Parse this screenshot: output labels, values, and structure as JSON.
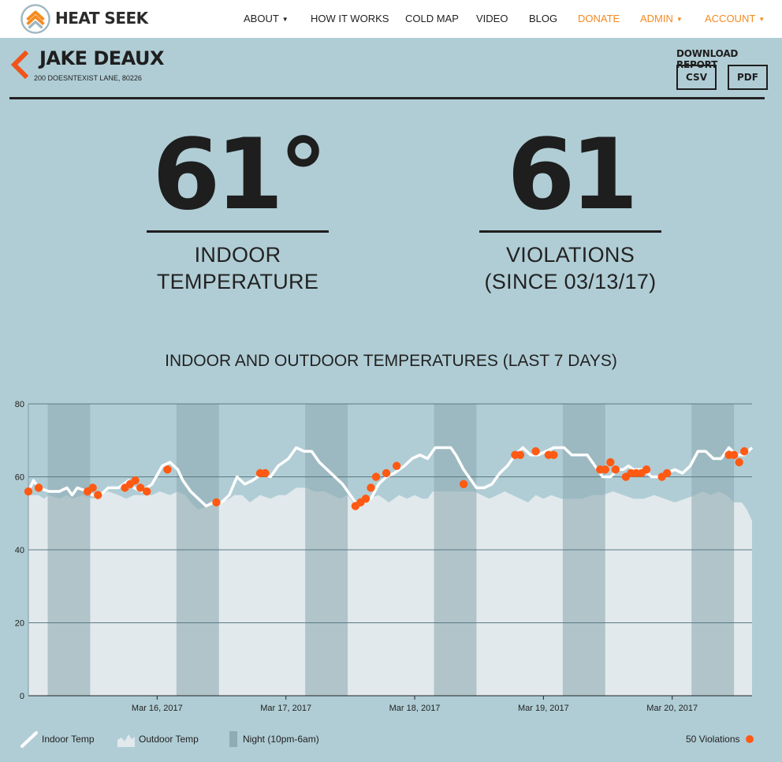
{
  "app": {
    "brand": "HEAT SEEK",
    "nav": [
      {
        "label": "ABOUT",
        "dropdown": true,
        "orange": false
      },
      {
        "label": "HOW IT WORKS",
        "dropdown": false,
        "orange": false
      },
      {
        "label": "COLD MAP",
        "dropdown": false,
        "orange": false
      },
      {
        "label": "VIDEO",
        "dropdown": false,
        "orange": false
      },
      {
        "label": "BLOG",
        "dropdown": false,
        "orange": false
      },
      {
        "label": "DONATE",
        "dropdown": false,
        "orange": true
      },
      {
        "label": "ADMIN",
        "dropdown": true,
        "orange": true
      },
      {
        "label": "ACCOUNT",
        "dropdown": true,
        "orange": true
      }
    ]
  },
  "tenant": {
    "name": "JAKE DEAUX",
    "address": "200 DOESNTEXIST LANE, 80226"
  },
  "download": {
    "label": "DOWNLOAD REPORT",
    "csv": "CSV",
    "pdf": "PDF"
  },
  "stats": {
    "temperature": {
      "value": "61°",
      "label_line1": "INDOOR",
      "label_line2": "TEMPERATURE"
    },
    "violations": {
      "value": "61",
      "label_line1": "VIOLATIONS",
      "label_line2": "(SINCE 03/13/17)"
    }
  },
  "colors": {
    "background": "#b0cdd5",
    "accent_orange": "#f58a1f",
    "violation": "#ff5a14",
    "indoor_line": "#ffffff",
    "outdoor_area": "#e1e9ec",
    "night_band": "#8fabb4"
  },
  "chart_data": {
    "type": "line",
    "title": "INDOOR AND OUTDOOR TEMPERATURES (LAST 7 DAYS)",
    "ylim": [
      0,
      80
    ],
    "yticks": [
      "0",
      "20",
      "40",
      "60",
      "80"
    ],
    "x_tick_labels": [
      {
        "label": "Mar 16, 2017",
        "t": 1.0
      },
      {
        "label": "Mar 17, 2017",
        "t": 2.0
      },
      {
        "label": "Mar 18, 2017",
        "t": 3.0
      },
      {
        "label": "Mar 19, 2017",
        "t": 4.0
      },
      {
        "label": "Mar 20, 2017",
        "t": 5.0
      }
    ],
    "x_range_days": [
      0.0,
      5.62
    ],
    "night_bands": [
      [
        0.15,
        0.48
      ],
      [
        1.15,
        1.48
      ],
      [
        2.15,
        2.48
      ],
      [
        3.15,
        3.48
      ],
      [
        4.15,
        4.48
      ],
      [
        5.15,
        5.48
      ]
    ],
    "series": [
      {
        "name": "Indoor Temp",
        "points": [
          [
            0.0,
            56
          ],
          [
            0.04,
            59
          ],
          [
            0.08,
            57
          ],
          [
            0.16,
            56
          ],
          [
            0.24,
            56
          ],
          [
            0.3,
            57
          ],
          [
            0.34,
            55
          ],
          [
            0.38,
            57
          ],
          [
            0.46,
            56
          ],
          [
            0.5,
            55
          ],
          [
            0.56,
            55
          ],
          [
            0.62,
            57
          ],
          [
            0.7,
            57
          ],
          [
            0.78,
            59
          ],
          [
            0.82,
            57
          ],
          [
            0.88,
            56
          ],
          [
            0.96,
            58
          ],
          [
            1.04,
            63
          ],
          [
            1.1,
            64
          ],
          [
            1.16,
            62
          ],
          [
            1.2,
            59
          ],
          [
            1.26,
            56
          ],
          [
            1.32,
            54
          ],
          [
            1.38,
            52
          ],
          [
            1.44,
            53
          ],
          [
            1.5,
            53
          ],
          [
            1.56,
            55
          ],
          [
            1.62,
            60
          ],
          [
            1.68,
            58
          ],
          [
            1.74,
            59
          ],
          [
            1.82,
            61
          ],
          [
            1.88,
            60
          ],
          [
            1.94,
            63
          ],
          [
            2.02,
            65
          ],
          [
            2.08,
            68
          ],
          [
            2.14,
            67
          ],
          [
            2.2,
            67
          ],
          [
            2.26,
            64
          ],
          [
            2.32,
            62
          ],
          [
            2.38,
            60
          ],
          [
            2.44,
            58
          ],
          [
            2.52,
            54
          ],
          [
            2.56,
            52
          ],
          [
            2.6,
            53
          ],
          [
            2.66,
            54
          ],
          [
            2.72,
            58
          ],
          [
            2.78,
            60
          ],
          [
            2.84,
            61
          ],
          [
            2.92,
            63
          ],
          [
            2.98,
            65
          ],
          [
            3.04,
            66
          ],
          [
            3.1,
            65
          ],
          [
            3.16,
            68
          ],
          [
            3.22,
            68
          ],
          [
            3.28,
            68
          ],
          [
            3.32,
            66
          ],
          [
            3.38,
            62
          ],
          [
            3.44,
            59
          ],
          [
            3.48,
            57
          ],
          [
            3.54,
            57
          ],
          [
            3.6,
            58
          ],
          [
            3.66,
            61
          ],
          [
            3.72,
            63
          ],
          [
            3.78,
            66
          ],
          [
            3.84,
            68
          ],
          [
            3.9,
            66
          ],
          [
            3.96,
            66
          ],
          [
            4.02,
            67
          ],
          [
            4.08,
            68
          ],
          [
            4.16,
            68
          ],
          [
            4.22,
            66
          ],
          [
            4.28,
            66
          ],
          [
            4.34,
            66
          ],
          [
            4.4,
            63
          ],
          [
            4.46,
            60
          ],
          [
            4.52,
            60
          ],
          [
            4.58,
            62
          ],
          [
            4.62,
            62
          ],
          [
            4.66,
            63
          ],
          [
            4.7,
            62
          ],
          [
            4.74,
            62
          ],
          [
            4.78,
            62
          ],
          [
            4.84,
            60
          ],
          [
            4.9,
            60
          ],
          [
            4.96,
            61
          ],
          [
            5.02,
            62
          ],
          [
            5.08,
            61
          ],
          [
            5.14,
            63
          ],
          [
            5.2,
            67
          ],
          [
            5.26,
            67
          ],
          [
            5.32,
            65
          ],
          [
            5.38,
            65
          ],
          [
            5.44,
            68
          ],
          [
            5.5,
            66
          ],
          [
            5.56,
            66
          ],
          [
            5.62,
            68
          ]
        ]
      },
      {
        "name": "Outdoor Temp",
        "points": [
          [
            0.0,
            55
          ],
          [
            0.08,
            55
          ],
          [
            0.12,
            54
          ],
          [
            0.16,
            55
          ],
          [
            0.24,
            54
          ],
          [
            0.3,
            55
          ],
          [
            0.34,
            54
          ],
          [
            0.42,
            55
          ],
          [
            0.5,
            54
          ],
          [
            0.56,
            55
          ],
          [
            0.62,
            56
          ],
          [
            0.7,
            55
          ],
          [
            0.76,
            54
          ],
          [
            0.82,
            55
          ],
          [
            0.88,
            55
          ],
          [
            0.96,
            55
          ],
          [
            1.02,
            56
          ],
          [
            1.1,
            55
          ],
          [
            1.16,
            56
          ],
          [
            1.22,
            55
          ],
          [
            1.26,
            53
          ],
          [
            1.32,
            51
          ],
          [
            1.4,
            52
          ],
          [
            1.44,
            53
          ],
          [
            1.5,
            53
          ],
          [
            1.56,
            54
          ],
          [
            1.6,
            55
          ],
          [
            1.66,
            55
          ],
          [
            1.72,
            53
          ],
          [
            1.8,
            55
          ],
          [
            1.88,
            54
          ],
          [
            1.94,
            55
          ],
          [
            2.0,
            55
          ],
          [
            2.08,
            57
          ],
          [
            2.16,
            57
          ],
          [
            2.22,
            56
          ],
          [
            2.3,
            56
          ],
          [
            2.36,
            55
          ],
          [
            2.42,
            54
          ],
          [
            2.48,
            55
          ],
          [
            2.52,
            53
          ],
          [
            2.58,
            53
          ],
          [
            2.64,
            54
          ],
          [
            2.72,
            55
          ],
          [
            2.8,
            53
          ],
          [
            2.88,
            55
          ],
          [
            2.94,
            54
          ],
          [
            3.0,
            55
          ],
          [
            3.06,
            54
          ],
          [
            3.1,
            54
          ],
          [
            3.14,
            56
          ],
          [
            3.2,
            56
          ],
          [
            3.3,
            56
          ],
          [
            3.38,
            56
          ],
          [
            3.46,
            56
          ],
          [
            3.52,
            55
          ],
          [
            3.58,
            54
          ],
          [
            3.64,
            55
          ],
          [
            3.7,
            56
          ],
          [
            3.76,
            55
          ],
          [
            3.82,
            54
          ],
          [
            3.88,
            53
          ],
          [
            3.94,
            55
          ],
          [
            4.0,
            54
          ],
          [
            4.06,
            55
          ],
          [
            4.14,
            54
          ],
          [
            4.22,
            54
          ],
          [
            4.3,
            54
          ],
          [
            4.38,
            55
          ],
          [
            4.46,
            55
          ],
          [
            4.54,
            56
          ],
          [
            4.62,
            55
          ],
          [
            4.7,
            54
          ],
          [
            4.78,
            54
          ],
          [
            4.86,
            55
          ],
          [
            4.94,
            54
          ],
          [
            5.02,
            53
          ],
          [
            5.1,
            54
          ],
          [
            5.18,
            55
          ],
          [
            5.24,
            56
          ],
          [
            5.3,
            55
          ],
          [
            5.36,
            56
          ],
          [
            5.42,
            55
          ],
          [
            5.48,
            53
          ],
          [
            5.54,
            53
          ],
          [
            5.58,
            51
          ],
          [
            5.62,
            48
          ]
        ]
      }
    ],
    "violations": [
      [
        0.0,
        56
      ],
      [
        0.08,
        57
      ],
      [
        0.46,
        56
      ],
      [
        0.5,
        57
      ],
      [
        0.54,
        55
      ],
      [
        0.75,
        57
      ],
      [
        0.79,
        58
      ],
      [
        0.83,
        59
      ],
      [
        0.87,
        57
      ],
      [
        0.92,
        56
      ],
      [
        1.08,
        62
      ],
      [
        1.46,
        53
      ],
      [
        1.8,
        61
      ],
      [
        1.84,
        61
      ],
      [
        2.54,
        52
      ],
      [
        2.58,
        53
      ],
      [
        2.62,
        54
      ],
      [
        2.66,
        57
      ],
      [
        2.7,
        60
      ],
      [
        2.78,
        61
      ],
      [
        2.86,
        63
      ],
      [
        3.38,
        58
      ],
      [
        3.78,
        66
      ],
      [
        3.82,
        66
      ],
      [
        3.94,
        67
      ],
      [
        4.04,
        66
      ],
      [
        4.08,
        66
      ],
      [
        4.44,
        62
      ],
      [
        4.48,
        62
      ],
      [
        4.52,
        64
      ],
      [
        4.56,
        62
      ],
      [
        4.64,
        60
      ],
      [
        4.68,
        61
      ],
      [
        4.72,
        61
      ],
      [
        4.76,
        61
      ],
      [
        4.8,
        62
      ],
      [
        4.92,
        60
      ],
      [
        4.96,
        61
      ],
      [
        5.44,
        66
      ],
      [
        5.48,
        66
      ],
      [
        5.52,
        64
      ],
      [
        5.56,
        67
      ]
    ],
    "legend": {
      "indoor": "Indoor Temp",
      "outdoor": "Outdoor Temp",
      "night": "Night (10pm-6am)",
      "violations": "50 Violations"
    }
  }
}
